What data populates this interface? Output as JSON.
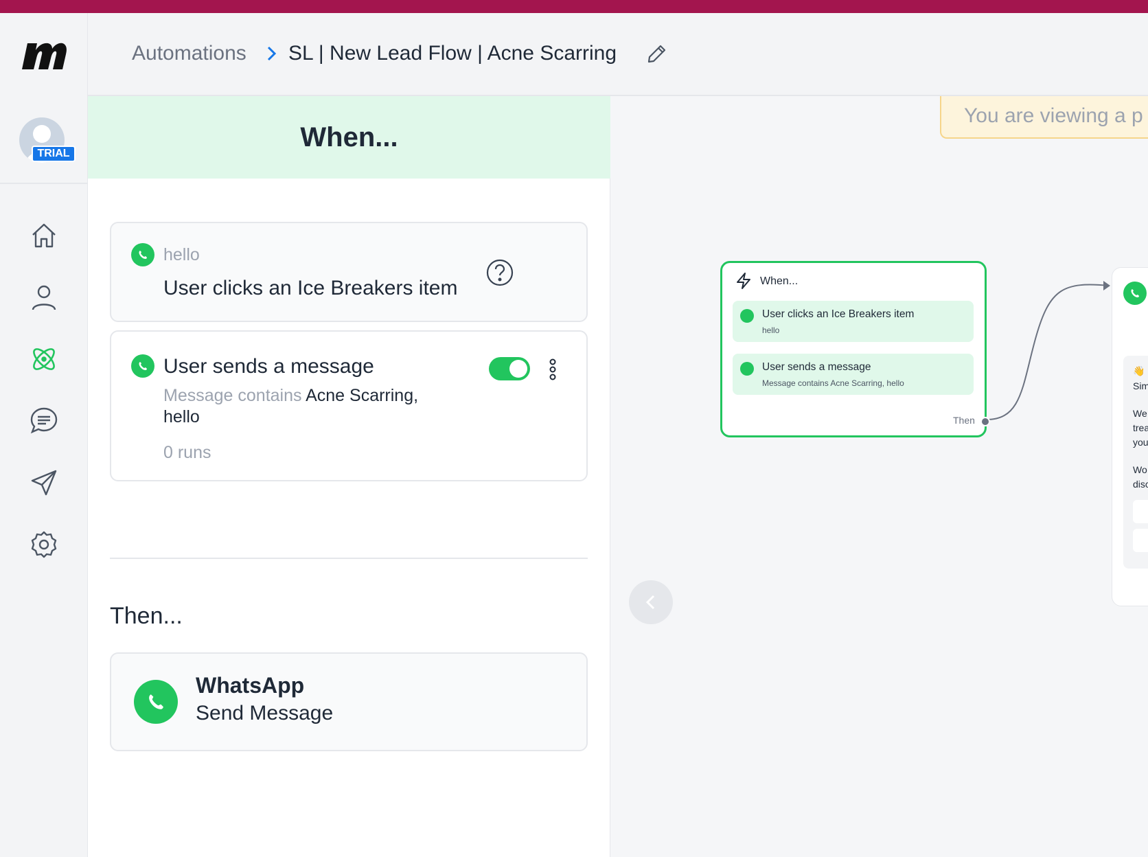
{
  "colors": {
    "topbar": "#a3154e",
    "accent_green": "#22c55e",
    "when_header_bg": "#e0f8ea",
    "trial_badge": "#1677e8",
    "banner_bg": "#fdf4dc"
  },
  "sidebar": {
    "logo_icon": "brand-logo-icon",
    "trial_badge": "TRIAL",
    "nav": [
      {
        "name": "home",
        "icon": "home-icon"
      },
      {
        "name": "contacts",
        "icon": "user-icon"
      },
      {
        "name": "automations",
        "icon": "atom-icon",
        "active": true
      },
      {
        "name": "chat",
        "icon": "chat-icon"
      },
      {
        "name": "broadcasts",
        "icon": "send-icon"
      },
      {
        "name": "settings",
        "icon": "gear-icon"
      }
    ]
  },
  "header": {
    "breadcrumb_root": "Automations",
    "breadcrumb_current": "SL | New Lead Flow | Acne Scarring"
  },
  "panel": {
    "when_title": "When...",
    "trigger1": {
      "keyword": "hello",
      "title": "User clicks an Ice Breakers item"
    },
    "trigger2": {
      "title": "User sends a message",
      "condition_prefix": "Message contains",
      "condition_value": "Acne Scarring,",
      "condition_value2": "hello",
      "runs": "0 runs",
      "enabled": true
    },
    "then_title": "Then...",
    "action": {
      "title": "WhatsApp",
      "subtitle": "Send Message"
    }
  },
  "canvas": {
    "banner_text": "You are viewing a p",
    "node": {
      "title": "When...",
      "rows": [
        {
          "title": "User clicks an Ice Breakers item",
          "sub": "hello"
        },
        {
          "title": "User sends a message",
          "sub": "Message contains Acne Scarring, hello"
        }
      ],
      "then_label": "Then"
    },
    "node2_fragments": [
      "Sim",
      "We",
      "trea",
      "you",
      "Wo",
      "disc"
    ]
  }
}
